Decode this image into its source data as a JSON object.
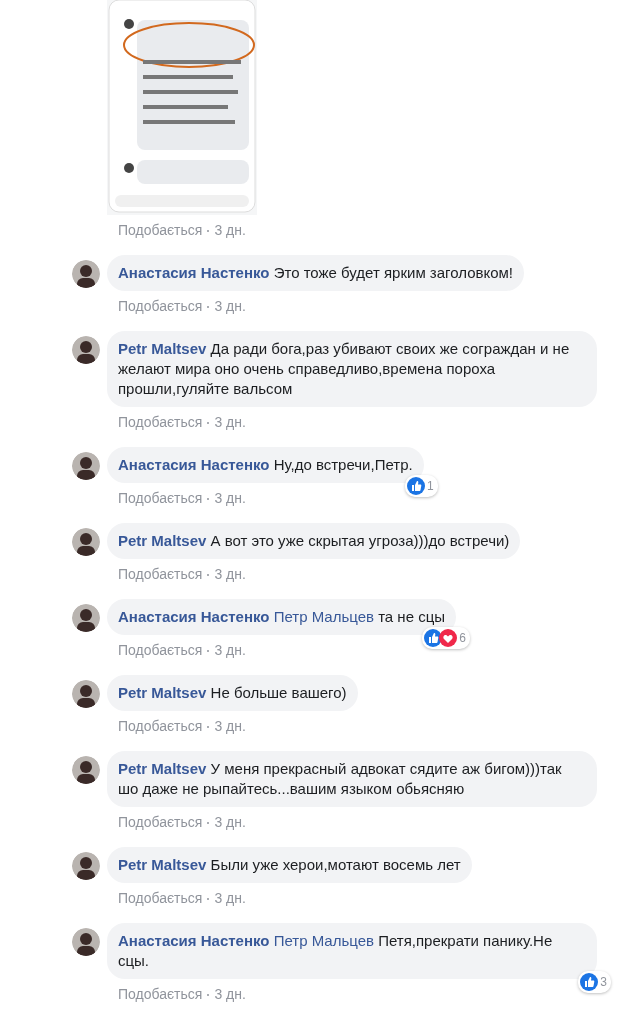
{
  "attachment": {
    "kind": "picture",
    "like": "Подобається",
    "time": "3 дн."
  },
  "comments": [
    {
      "author": "Анастасия Настенко",
      "text": "Это тоже будет ярким заголовком!",
      "like": "Подобається",
      "time": "3 дн."
    },
    {
      "author": "Petr Maltsev",
      "text": "Да ради бога,раз убивают своих же сограждан и не желают мира оно очень справедливо,времена пороха прошли,гуляйте вальсом",
      "like": "Подобається",
      "time": "3 дн."
    },
    {
      "author": "Анастасия Настенко",
      "text": "Ну,до встречи,Петр.",
      "like": "Подобається",
      "time": "3 дн.",
      "reactions": {
        "icons": [
          {
            "kind": "like"
          }
        ],
        "count": "1"
      }
    },
    {
      "author": "Petr Maltsev",
      "text": "А вот это уже скрытая угроза)))до встречи)",
      "like": "Подобається",
      "time": "3 дн."
    },
    {
      "author": "Анастасия Настенко",
      "mention": "Петр Мальцев",
      "text": "та не сцы",
      "like": "Подобається",
      "time": "3 дн.",
      "reactions": {
        "icons": [
          {
            "kind": "like"
          },
          {
            "kind": "love"
          }
        ],
        "count": "6"
      }
    },
    {
      "author": "Petr Maltsev",
      "text": "Не больше вашего)",
      "like": "Подобається",
      "time": "3 дн."
    },
    {
      "author": "Petr Maltsev",
      "text": "У меня прекрасный адвокат сядите аж бигом)))так шо даже не рыпайтесь...вашим языком обьясняю",
      "like": "Подобається",
      "time": "3 дн."
    },
    {
      "author": "Petr Maltsev",
      "text": "Были уже херои,мотают восемь лет",
      "like": "Подобається",
      "time": "3 дн."
    },
    {
      "author": "Анастасия Настенко",
      "mention": "Петр Мальцев",
      "text": "Петя,прекрати панику.Не сцы.",
      "like": "Подобається",
      "time": "3 дн.",
      "reactions": {
        "icons": [
          {
            "kind": "like"
          }
        ],
        "count": "3"
      }
    }
  ]
}
